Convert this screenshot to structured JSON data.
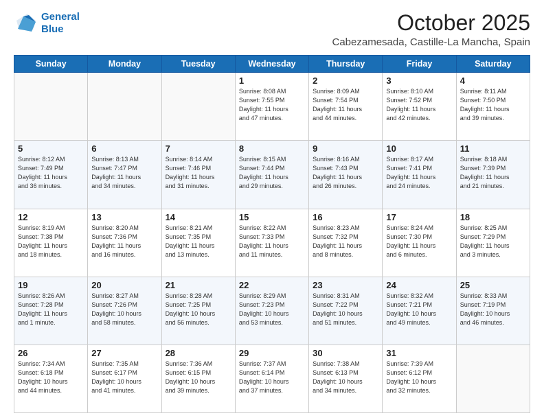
{
  "header": {
    "logo_line1": "General",
    "logo_line2": "Blue",
    "month": "October 2025",
    "location": "Cabezamesada, Castille-La Mancha, Spain"
  },
  "days_of_week": [
    "Sunday",
    "Monday",
    "Tuesday",
    "Wednesday",
    "Thursday",
    "Friday",
    "Saturday"
  ],
  "weeks": [
    [
      {
        "day": "",
        "info": ""
      },
      {
        "day": "",
        "info": ""
      },
      {
        "day": "",
        "info": ""
      },
      {
        "day": "1",
        "info": "Sunrise: 8:08 AM\nSunset: 7:55 PM\nDaylight: 11 hours\nand 47 minutes."
      },
      {
        "day": "2",
        "info": "Sunrise: 8:09 AM\nSunset: 7:54 PM\nDaylight: 11 hours\nand 44 minutes."
      },
      {
        "day": "3",
        "info": "Sunrise: 8:10 AM\nSunset: 7:52 PM\nDaylight: 11 hours\nand 42 minutes."
      },
      {
        "day": "4",
        "info": "Sunrise: 8:11 AM\nSunset: 7:50 PM\nDaylight: 11 hours\nand 39 minutes."
      }
    ],
    [
      {
        "day": "5",
        "info": "Sunrise: 8:12 AM\nSunset: 7:49 PM\nDaylight: 11 hours\nand 36 minutes."
      },
      {
        "day": "6",
        "info": "Sunrise: 8:13 AM\nSunset: 7:47 PM\nDaylight: 11 hours\nand 34 minutes."
      },
      {
        "day": "7",
        "info": "Sunrise: 8:14 AM\nSunset: 7:46 PM\nDaylight: 11 hours\nand 31 minutes."
      },
      {
        "day": "8",
        "info": "Sunrise: 8:15 AM\nSunset: 7:44 PM\nDaylight: 11 hours\nand 29 minutes."
      },
      {
        "day": "9",
        "info": "Sunrise: 8:16 AM\nSunset: 7:43 PM\nDaylight: 11 hours\nand 26 minutes."
      },
      {
        "day": "10",
        "info": "Sunrise: 8:17 AM\nSunset: 7:41 PM\nDaylight: 11 hours\nand 24 minutes."
      },
      {
        "day": "11",
        "info": "Sunrise: 8:18 AM\nSunset: 7:39 PM\nDaylight: 11 hours\nand 21 minutes."
      }
    ],
    [
      {
        "day": "12",
        "info": "Sunrise: 8:19 AM\nSunset: 7:38 PM\nDaylight: 11 hours\nand 18 minutes."
      },
      {
        "day": "13",
        "info": "Sunrise: 8:20 AM\nSunset: 7:36 PM\nDaylight: 11 hours\nand 16 minutes."
      },
      {
        "day": "14",
        "info": "Sunrise: 8:21 AM\nSunset: 7:35 PM\nDaylight: 11 hours\nand 13 minutes."
      },
      {
        "day": "15",
        "info": "Sunrise: 8:22 AM\nSunset: 7:33 PM\nDaylight: 11 hours\nand 11 minutes."
      },
      {
        "day": "16",
        "info": "Sunrise: 8:23 AM\nSunset: 7:32 PM\nDaylight: 11 hours\nand 8 minutes."
      },
      {
        "day": "17",
        "info": "Sunrise: 8:24 AM\nSunset: 7:30 PM\nDaylight: 11 hours\nand 6 minutes."
      },
      {
        "day": "18",
        "info": "Sunrise: 8:25 AM\nSunset: 7:29 PM\nDaylight: 11 hours\nand 3 minutes."
      }
    ],
    [
      {
        "day": "19",
        "info": "Sunrise: 8:26 AM\nSunset: 7:28 PM\nDaylight: 11 hours\nand 1 minute."
      },
      {
        "day": "20",
        "info": "Sunrise: 8:27 AM\nSunset: 7:26 PM\nDaylight: 10 hours\nand 58 minutes."
      },
      {
        "day": "21",
        "info": "Sunrise: 8:28 AM\nSunset: 7:25 PM\nDaylight: 10 hours\nand 56 minutes."
      },
      {
        "day": "22",
        "info": "Sunrise: 8:29 AM\nSunset: 7:23 PM\nDaylight: 10 hours\nand 53 minutes."
      },
      {
        "day": "23",
        "info": "Sunrise: 8:31 AM\nSunset: 7:22 PM\nDaylight: 10 hours\nand 51 minutes."
      },
      {
        "day": "24",
        "info": "Sunrise: 8:32 AM\nSunset: 7:21 PM\nDaylight: 10 hours\nand 49 minutes."
      },
      {
        "day": "25",
        "info": "Sunrise: 8:33 AM\nSunset: 7:19 PM\nDaylight: 10 hours\nand 46 minutes."
      }
    ],
    [
      {
        "day": "26",
        "info": "Sunrise: 7:34 AM\nSunset: 6:18 PM\nDaylight: 10 hours\nand 44 minutes."
      },
      {
        "day": "27",
        "info": "Sunrise: 7:35 AM\nSunset: 6:17 PM\nDaylight: 10 hours\nand 41 minutes."
      },
      {
        "day": "28",
        "info": "Sunrise: 7:36 AM\nSunset: 6:15 PM\nDaylight: 10 hours\nand 39 minutes."
      },
      {
        "day": "29",
        "info": "Sunrise: 7:37 AM\nSunset: 6:14 PM\nDaylight: 10 hours\nand 37 minutes."
      },
      {
        "day": "30",
        "info": "Sunrise: 7:38 AM\nSunset: 6:13 PM\nDaylight: 10 hours\nand 34 minutes."
      },
      {
        "day": "31",
        "info": "Sunrise: 7:39 AM\nSunset: 6:12 PM\nDaylight: 10 hours\nand 32 minutes."
      },
      {
        "day": "",
        "info": ""
      }
    ]
  ]
}
